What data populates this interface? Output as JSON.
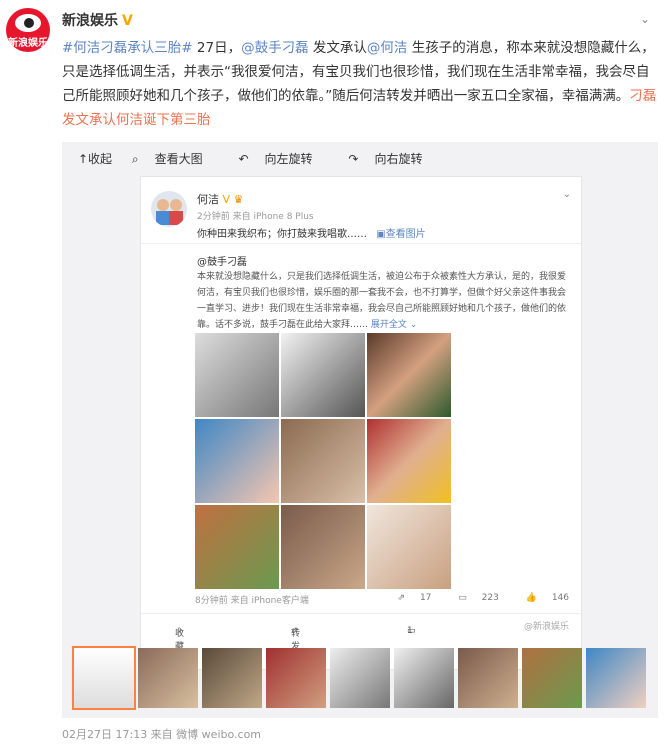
{
  "author": {
    "name": "新浪娱乐",
    "avatar_text": "新浪娱乐",
    "verified": "V"
  },
  "post": {
    "text_segments": [
      {
        "t": "#何洁刁磊承认三胎# ",
        "c": "lb"
      },
      {
        "t": "27日，",
        "c": ""
      },
      {
        "t": "@鼓手刁磊",
        "c": "lb"
      },
      {
        "t": " 发文承认",
        "c": ""
      },
      {
        "t": "@何洁",
        "c": "lb"
      },
      {
        "t": " 生孩子的消息，称本来就没想隐藏什么，只是选择低调生活，并表示“我很爱何洁，有宝贝我们也很珍惜，我们现在生活非常幸福，我会尽自己所能照顾好她和几个孩子，做他们的依靠。”随后何洁转发并晒出一家五口全家福，幸福满满。",
        "c": ""
      },
      {
        "t": "刁磊发文承认何洁诞下第三胎",
        "c": "lk"
      }
    ]
  },
  "media_toolbar": {
    "collapse": "↑收起",
    "view_large": "查看大图",
    "rotate_left": "向左旋转",
    "rotate_right": "向右旋转"
  },
  "card": {
    "name": "何洁",
    "meta": "2分钟前 来自 iPhone 8 Plus",
    "quote": "你种田来我织布；你打鼓来我唱歌……",
    "view_pic": "查看图片",
    "at": "@鼓手刁磊",
    "body": "本来就没想隐藏什么，只是我们选择低调生活，被迫公布于众被素性大方承认，是的，我很爱何洁，有宝贝我们也很珍惜，娱乐圈的那一套我不会，也不打算学，但做个好父亲这件事我会一直学习、进步！我们现在生活非常幸福，我会尽自己所能照顾好她和几个孩子，做他们的依靠。话不多说，鼓手刁磊在此给大家拜……",
    "expand": "展开全文",
    "footer_time": "8分钟前 来自 iPhone客户端",
    "repost_count": "17",
    "comment_count": "223",
    "like_count": "146",
    "bar_collect": "收藏",
    "bar_forward": "转发",
    "bar_comment": "1",
    "watermark": "@新浪娱乐"
  },
  "bottom": "02月27日 17:13 来自 微博 weibo.com"
}
